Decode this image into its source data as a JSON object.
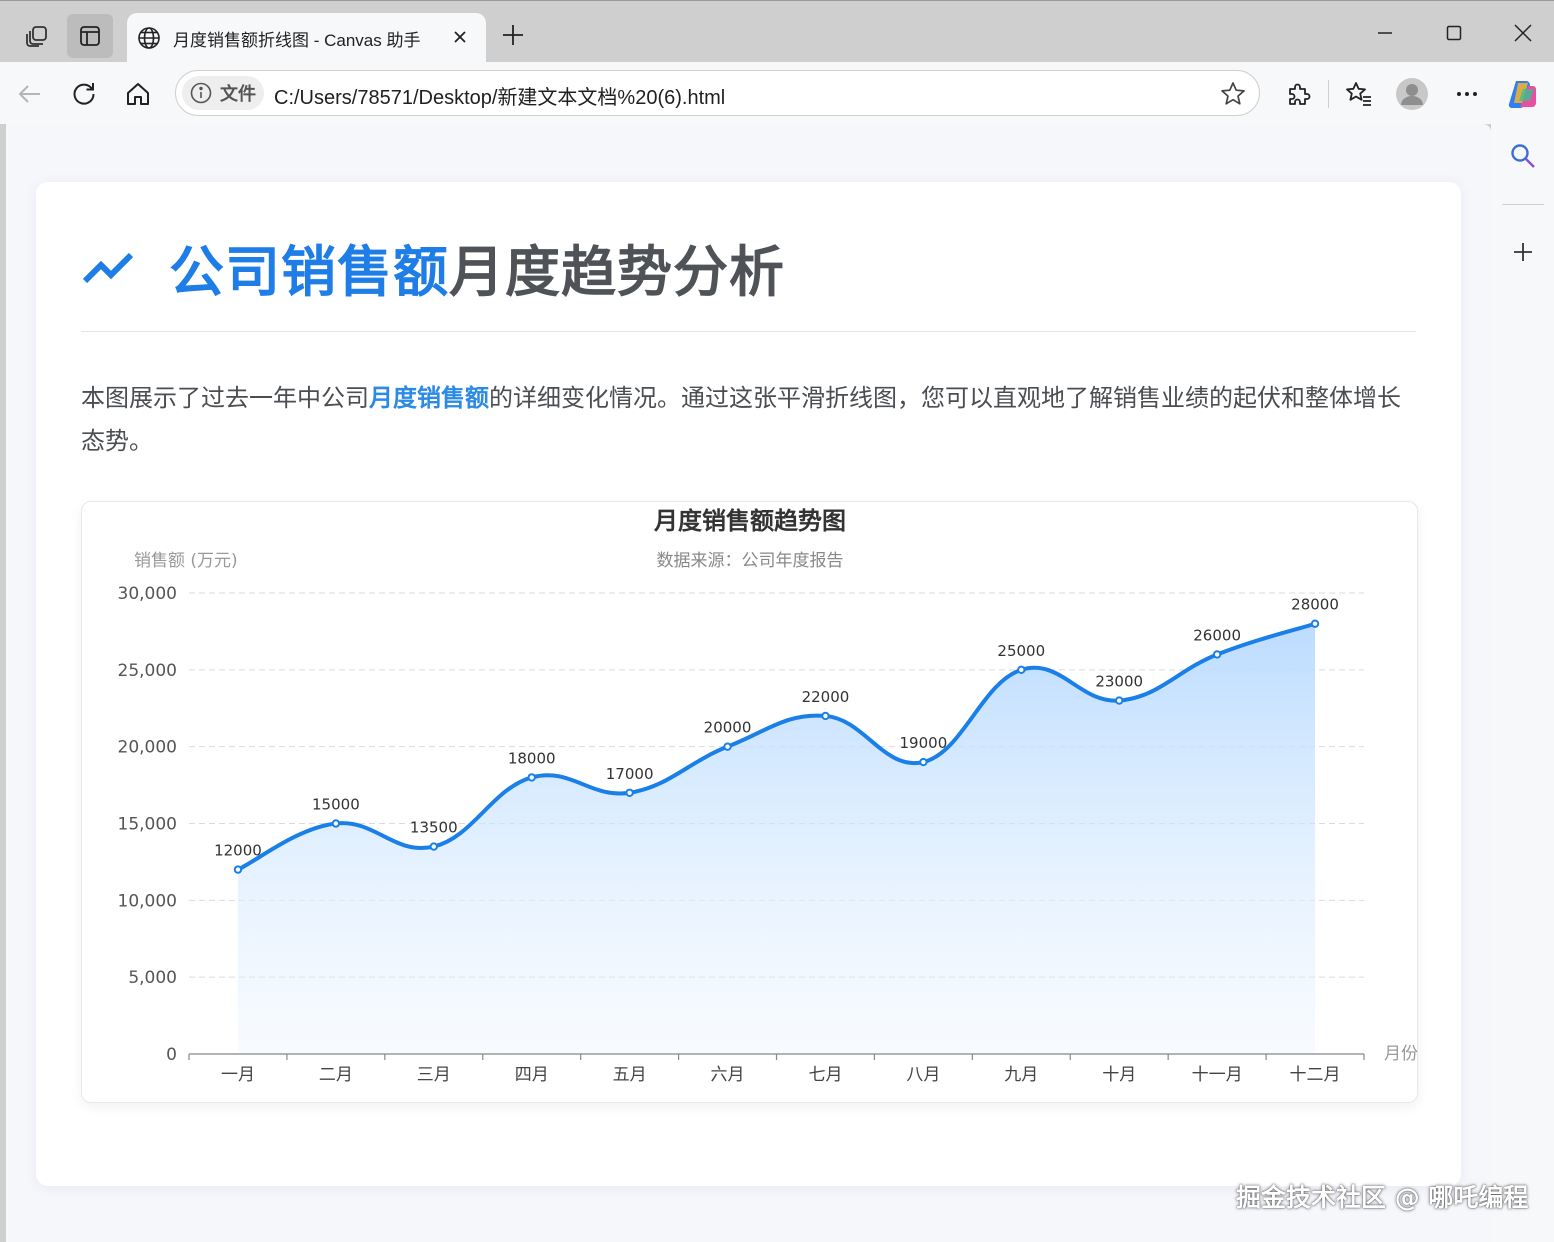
{
  "browser": {
    "tab_title": "月度销售额折线图 - Canvas 助手",
    "address_chip": "文件",
    "url": "C:/Users/78571/Desktop/新建文本文档%20(6).html"
  },
  "page": {
    "title_highlight": "公司销售额",
    "title_rest": "月度趋势分析",
    "desc_before": "本图展示了过去一年中公司",
    "desc_highlight": "月度销售额",
    "desc_after": "的详细变化情况。通过这张平滑折线图，您可以直观地了解销售业绩的起伏和整体增长态势。"
  },
  "chart_data": {
    "type": "area",
    "title": "月度销售额趋势图",
    "subtitle": "数据来源：公司年度报告",
    "ylabel": "销售额 (万元)",
    "xlabel": "月份",
    "categories": [
      "一月",
      "二月",
      "三月",
      "四月",
      "五月",
      "六月",
      "七月",
      "八月",
      "九月",
      "十月",
      "十一月",
      "十二月"
    ],
    "values": [
      12000,
      15000,
      13500,
      18000,
      17000,
      20000,
      22000,
      19000,
      25000,
      23000,
      26000,
      28000
    ],
    "ylim": [
      0,
      30000
    ],
    "yticks": [
      0,
      5000,
      10000,
      15000,
      20000,
      25000,
      30000
    ],
    "ytick_labels": [
      "0",
      "5,000",
      "10,000",
      "15,000",
      "20,000",
      "25,000",
      "30,000"
    ],
    "grid": true,
    "smooth": true,
    "line_color": "#1a7fe8"
  },
  "watermark": "掘金技术社区 @ 哪吒编程"
}
